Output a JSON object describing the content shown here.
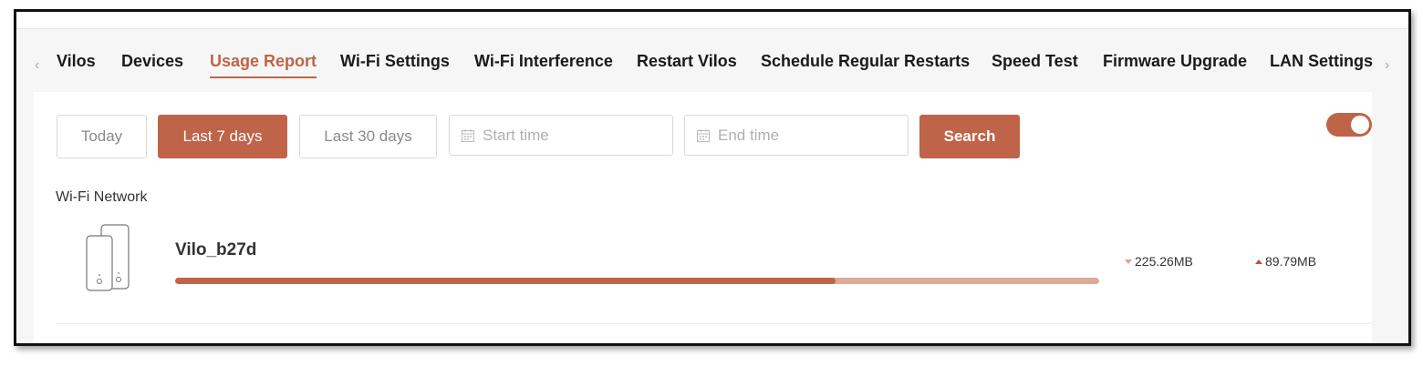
{
  "tabs": {
    "items": [
      {
        "label": "Vilos"
      },
      {
        "label": "Devices"
      },
      {
        "label": "Usage Report"
      },
      {
        "label": "Wi-Fi Settings"
      },
      {
        "label": "Wi-Fi Interference"
      },
      {
        "label": "Restart Vilos"
      },
      {
        "label": "Schedule Regular Restarts"
      },
      {
        "label": "Speed Test"
      },
      {
        "label": "Firmware Upgrade"
      },
      {
        "label": "LAN Settings"
      }
    ],
    "active": "Usage Report",
    "prev_icon": "‹",
    "next_icon": "›"
  },
  "filters": {
    "today_label": "Today",
    "last7_label": "Last 7 days",
    "last30_label": "Last 30 days",
    "selected": "Last 7 days",
    "start_placeholder": "Start time",
    "end_placeholder": "End time",
    "search_label": "Search"
  },
  "toggle": {
    "on": true
  },
  "wifi": {
    "section_label": "Wi-Fi Network",
    "network_name": "Vilo_b27d",
    "usage_fraction": 0.715,
    "download": "225.26MB",
    "upload": "89.79MB"
  },
  "colors": {
    "accent": "#bf6448",
    "bar_track": "#ddaa99"
  },
  "icons": {
    "calendar": "calendar-icon",
    "router": "router-device-icon",
    "download": "triangle-down-icon",
    "upload": "triangle-up-icon"
  }
}
